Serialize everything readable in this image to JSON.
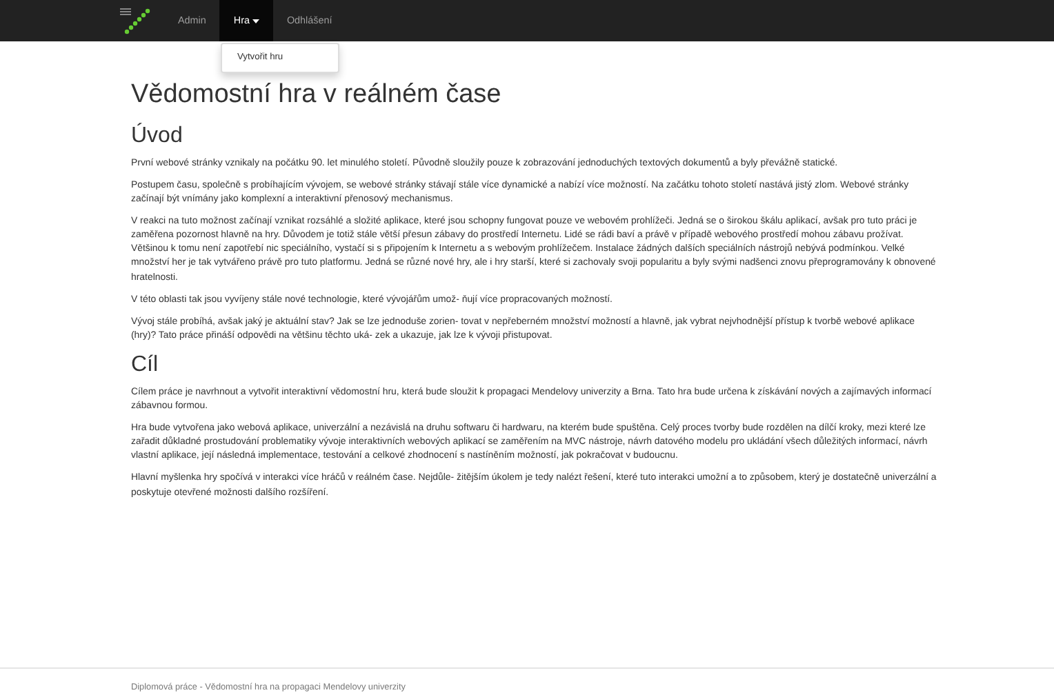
{
  "navbar": {
    "items": [
      {
        "label": "Admin",
        "selected": false,
        "dropdown": false
      },
      {
        "label": "Hra",
        "selected": true,
        "dropdown": true
      },
      {
        "label": "Odhlášení",
        "selected": false,
        "dropdown": false
      }
    ]
  },
  "dropdown_menu": {
    "items": [
      "Vytvořit hru"
    ]
  },
  "title": "Vědomostní hra v reálném čase",
  "sections": [
    {
      "heading": "Úvod",
      "paragraphs": [
        "První webové stránky vznikaly na počátku 90. let minulého století. Původně sloužily pouze k zobrazování jednoduchých textových dokumentů a byly převážně statické.",
        "Postupem času, společně s probíhajícím vývojem, se webové stránky stávají stále více dynamické a nabízí více možností. Na začátku tohoto století nastává jistý zlom. Webové stránky začínají být vnímány jako komplexní a interaktivní přenosový mechanismus.",
        "V reakci na tuto možnost začínají vznikat rozsáhlé a složité aplikace, které jsou schopny fungovat pouze ve webovém prohlížeči. Jedná se o širokou škálu aplikací, avšak pro tuto práci je zaměřena pozornost hlavně na hry. Důvodem je totiž stále větší přesun zábavy do prostředí Internetu. Lidé se rádi baví a právě v případě webového prostředí mohou zábavu prožívat. Většinou k tomu není zapotřebí nic speciálního, vystačí si s připojením k Internetu a s webovým prohlížečem. Instalace žádných dalších speciálních nástrojů nebývá podmínkou. Velké množství her je tak vytvářeno právě pro tuto platformu. Jedná se různé nové hry, ale i hry starší, které si zachovaly svoji popularitu a byly svými nadšenci znovu přeprogramovány k obnovené hratelnosti.",
        "V této oblasti tak jsou vyvíjeny stále nové technologie, které vývojářům umož- ňují více propracovaných možností.",
        "Vývoj stále probíhá, avšak jaký je aktuální stav? Jak se lze jednoduše zorien- tovat v nepřeberném množství možností a hlavně, jak vybrat nejvhodnější přístup k tvorbě webové aplikace (hry)? Tato práce přináší odpovědi na většinu těchto uká- zek a ukazuje, jak lze k vývoji přistupovat."
      ]
    },
    {
      "heading": "Cíl",
      "paragraphs": [
        "Cílem práce je navrhnout a vytvořit interaktivní vědomostní hru, která bude sloužit k propagaci Mendelovy univerzity a Brna. Tato hra bude určena k získávání nových a zajímavých informací zábavnou formou.",
        "Hra bude vytvořena jako webová aplikace, univerzální a nezávislá na druhu softwaru či hardwaru, na kterém bude spuštěna. Celý proces tvorby bude rozdělen na dílčí kroky, mezi které lze zařadit důkladné prostudování problematiky vývoje interaktivních webových aplikací se zaměřením na MVC nástroje, návrh datového modelu pro ukládání všech důležitých informací, návrh vlastní aplikace, její následná implementace, testování a celkové zhodnocení s nastíněním možností, jak pokračovat v budoucnu.",
        "Hlavní myšlenka hry spočívá v interakci více hráčů v reálném čase. Nejdůle- žitějším úkolem je tedy nalézt řešení, které tuto interakci umožní a to způsobem, který je dostatečně univerzální a poskytuje otevřené možnosti dalšího rozšíření."
      ]
    }
  ],
  "footer": "Diplomová práce - Vědomostní hra na propagaci Mendelovy univerzity"
}
